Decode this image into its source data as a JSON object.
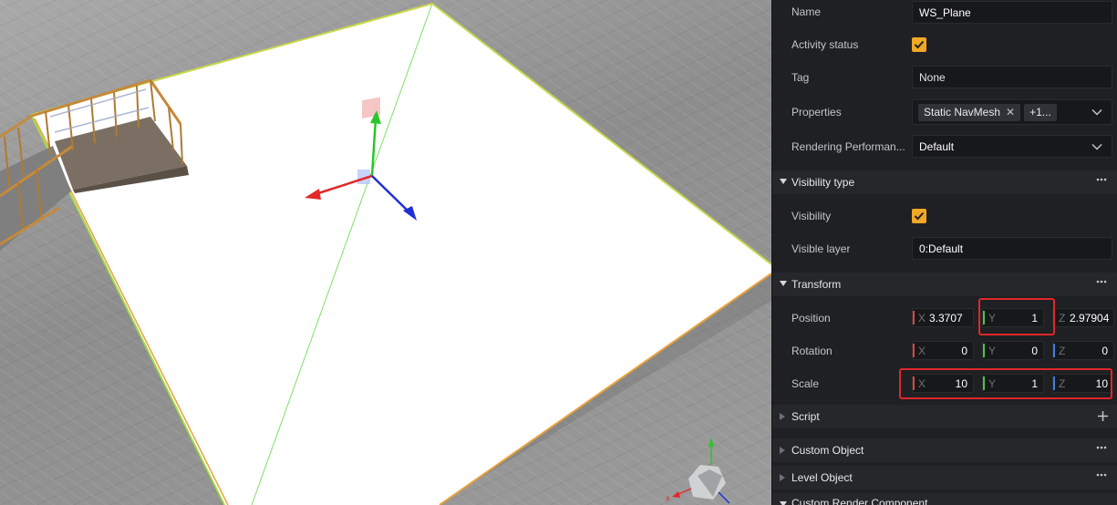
{
  "inspector": {
    "name": {
      "label": "Name",
      "value": "WS_Plane"
    },
    "activity": {
      "label": "Activity status",
      "checked": true
    },
    "tag": {
      "label": "Tag",
      "value": "None"
    },
    "properties": {
      "label": "Properties",
      "tags": [
        "Static NavMesh",
        "+1..."
      ]
    },
    "rendering": {
      "label": "Rendering Performan...",
      "value": "Default"
    },
    "visibility_section": {
      "title": "Visibility type"
    },
    "visibility": {
      "label": "Visibility",
      "checked": true
    },
    "visible_layer": {
      "label": "Visible layer",
      "value": "0:Default"
    },
    "transform_section": {
      "title": "Transform"
    },
    "position": {
      "label": "Position",
      "x": "3.3707",
      "y": "1",
      "z": "2.97904"
    },
    "rotation": {
      "label": "Rotation",
      "x": "0",
      "y": "0",
      "z": "0"
    },
    "scale": {
      "label": "Scale",
      "x": "10",
      "y": "1",
      "z": "10"
    },
    "axis_labels": {
      "x": "X",
      "y": "Y",
      "z": "Z"
    },
    "script_section": {
      "title": "Script"
    },
    "custom_object_section": {
      "title": "Custom Object"
    },
    "level_object_section": {
      "title": "Level Object"
    },
    "custom_render_section": {
      "title": "Custom Render Component"
    }
  },
  "colors": {
    "accent": "#f0a825",
    "axis_x": "#e0453f",
    "axis_y": "#4fc24a",
    "axis_z": "#3f7fe0",
    "highlight": "#e0262a",
    "panel_bg": "#1f2023"
  },
  "viewport": {
    "gizmo_icon": "move-gizmo-icon",
    "orientation_icon": "scene-orientation-gizmo-icon",
    "orientation_axis_label": "x"
  }
}
